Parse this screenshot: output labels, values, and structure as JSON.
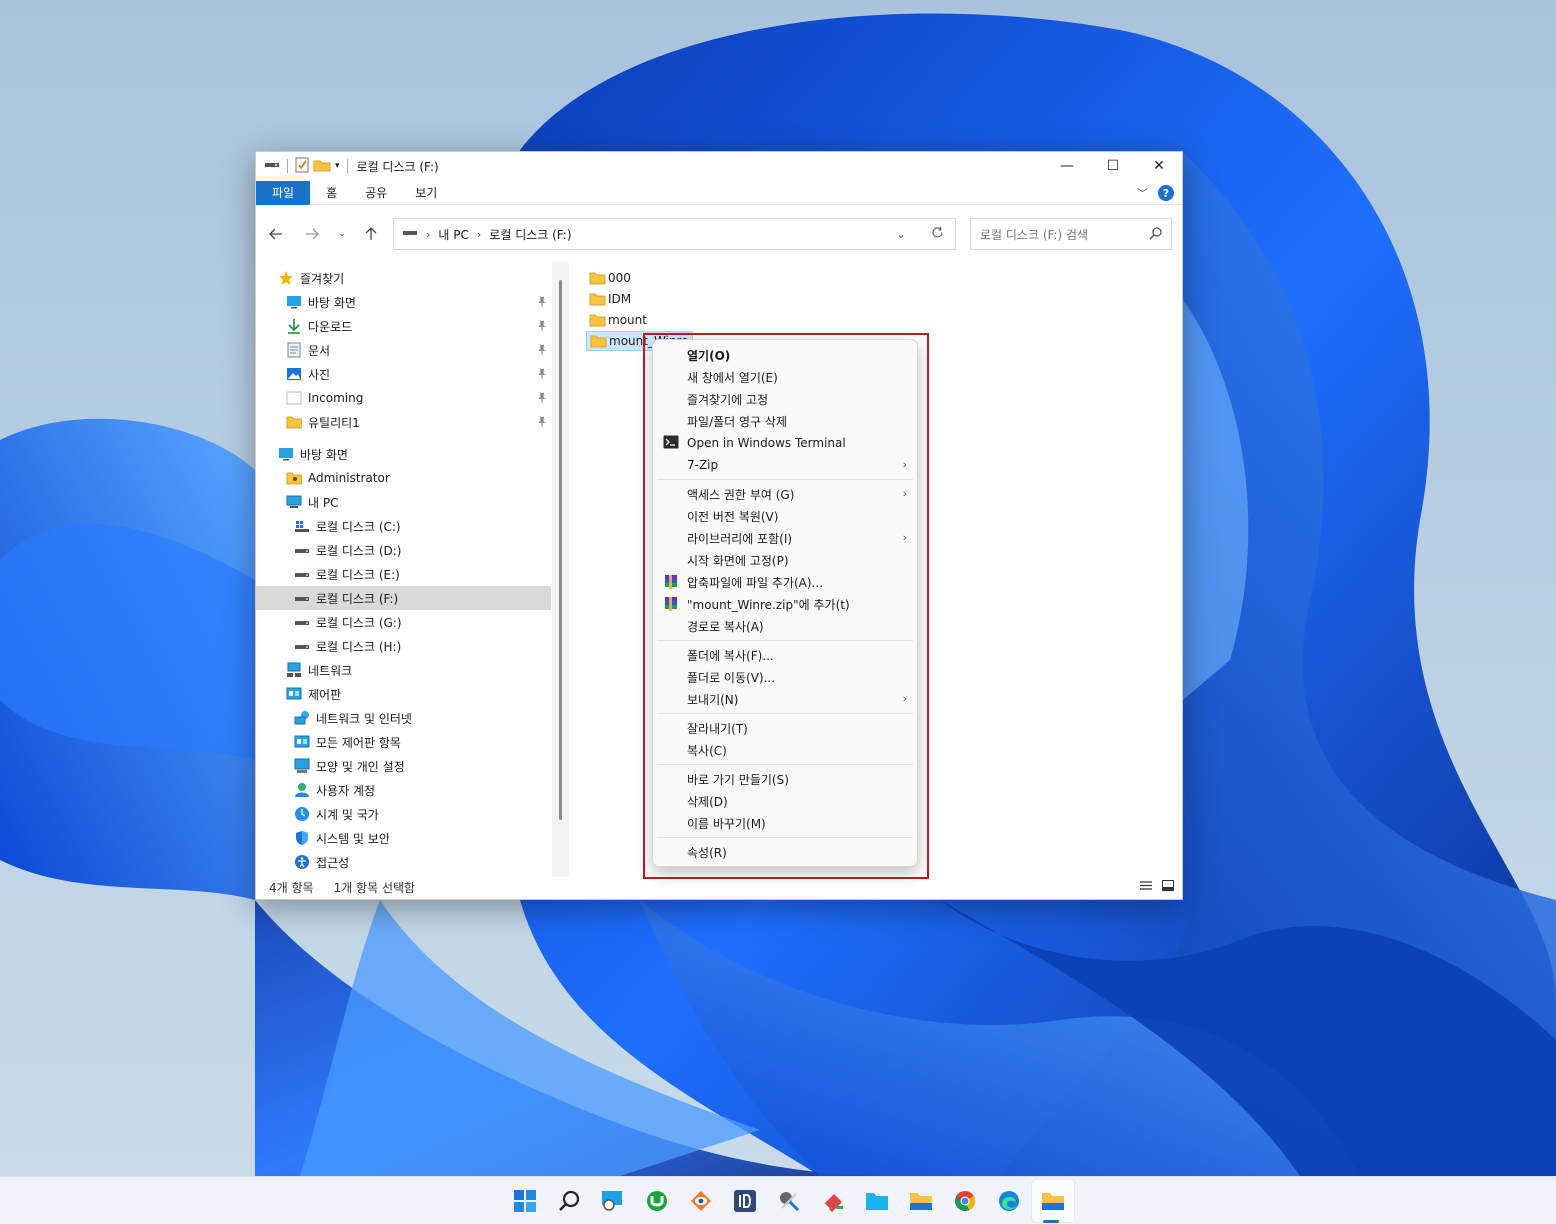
{
  "window": {
    "title": "로컬 디스크 (F:)",
    "controls": {
      "minimize": "—",
      "maximize": "☐",
      "close": "✕"
    }
  },
  "ribbon": {
    "tabs": [
      "파일",
      "홈",
      "공유",
      "보기"
    ],
    "help": "?"
  },
  "address": {
    "crumbs": [
      "내 PC",
      "로컬 디스크 (F:)"
    ],
    "search_placeholder": "로컬 디스크 (F:) 검색"
  },
  "sidebar": {
    "items": [
      {
        "label": "즐겨찾기",
        "icon": "star-icon",
        "level": 0,
        "pinned": false
      },
      {
        "label": "바탕 화면",
        "icon": "desktop-icon",
        "level": 1,
        "pinned": true
      },
      {
        "label": "다운로드",
        "icon": "download-icon",
        "level": 1,
        "pinned": true
      },
      {
        "label": "문서",
        "icon": "document-icon",
        "level": 1,
        "pinned": true
      },
      {
        "label": "사진",
        "icon": "pictures-icon",
        "level": 1,
        "pinned": true
      },
      {
        "label": "Incoming",
        "icon": "blank-folder-icon",
        "level": 1,
        "pinned": true
      },
      {
        "label": "유틸리티1",
        "icon": "folder-icon",
        "level": 1,
        "pinned": true
      },
      {
        "label": "바탕 화면",
        "icon": "desktop-icon",
        "level": 0,
        "pinned": false
      },
      {
        "label": "Administrator",
        "icon": "user-folder-icon",
        "level": 1,
        "pinned": false
      },
      {
        "label": "내 PC",
        "icon": "pc-icon",
        "level": 1,
        "pinned": false
      },
      {
        "label": "로컬 디스크 (C:)",
        "icon": "windows-drive-icon",
        "level": 2,
        "pinned": false
      },
      {
        "label": "로컬 디스크 (D:)",
        "icon": "drive-icon",
        "level": 2,
        "pinned": false
      },
      {
        "label": "로컬 디스크 (E:)",
        "icon": "drive-icon",
        "level": 2,
        "pinned": false
      },
      {
        "label": "로컬 디스크 (F:)",
        "icon": "drive-icon",
        "level": 2,
        "pinned": false,
        "selected": true
      },
      {
        "label": "로컬 디스크 (G:)",
        "icon": "drive-icon",
        "level": 2,
        "pinned": false
      },
      {
        "label": "로컬 디스크 (H:)",
        "icon": "drive-icon",
        "level": 2,
        "pinned": false
      },
      {
        "label": "네트워크",
        "icon": "network-icon",
        "level": 1,
        "pinned": false
      },
      {
        "label": "제어판",
        "icon": "control-panel-icon",
        "level": 1,
        "pinned": false
      },
      {
        "label": "네트워크 및 인터넷",
        "icon": "network-internet-icon",
        "level": 2,
        "pinned": false
      },
      {
        "label": "모든 제어판 항목",
        "icon": "control-panel-icon",
        "level": 2,
        "pinned": false
      },
      {
        "label": "모양 및 개인 설정",
        "icon": "appearance-icon",
        "level": 2,
        "pinned": false
      },
      {
        "label": "사용자 계정",
        "icon": "user-accounts-icon",
        "level": 2,
        "pinned": false
      },
      {
        "label": "시계 및 국가",
        "icon": "clock-region-icon",
        "level": 2,
        "pinned": false
      },
      {
        "label": "시스템 및 보안",
        "icon": "shield-icon",
        "level": 2,
        "pinned": false
      },
      {
        "label": "접근성",
        "icon": "accessibility-icon",
        "level": 2,
        "pinned": false
      }
    ]
  },
  "files": [
    {
      "name": "000"
    },
    {
      "name": "IDM"
    },
    {
      "name": "mount"
    },
    {
      "name": "mount_Winre",
      "selected": true
    }
  ],
  "status": {
    "count": "4개 항목",
    "selection": "1개 항목 선택함"
  },
  "context_menu": {
    "groups": [
      [
        {
          "label": "열기(O)",
          "bold": true
        },
        {
          "label": "새 창에서 열기(E)"
        },
        {
          "label": "즐겨찾기에 고정"
        },
        {
          "label": "파일/폴더 영구 삭제"
        },
        {
          "label": "Open in Windows Terminal",
          "icon": "terminal-icon"
        },
        {
          "label": "7-Zip",
          "submenu": true
        }
      ],
      [
        {
          "label": "액세스 권한 부여 (G)",
          "submenu": true
        },
        {
          "label": "이전 버전 복원(V)"
        },
        {
          "label": "라이브러리에 포함(I)",
          "submenu": true
        },
        {
          "label": "시작 화면에 고정(P)"
        },
        {
          "label": "압축파일에 파일 추가(A)...",
          "icon": "winrar-icon"
        },
        {
          "label": "\"mount_Winre.zip\"에 추가(t)",
          "icon": "winrar-icon"
        },
        {
          "label": "경로로 복사(A)"
        }
      ],
      [
        {
          "label": "폴더에 복사(F)..."
        },
        {
          "label": "폴더로 이동(V)..."
        },
        {
          "label": "보내기(N)",
          "submenu": true
        }
      ],
      [
        {
          "label": "잘라내기(T)"
        },
        {
          "label": "복사(C)"
        }
      ],
      [
        {
          "label": "바로 가기 만들기(S)"
        },
        {
          "label": "삭제(D)"
        },
        {
          "label": "이름 바꾸기(M)"
        }
      ],
      [
        {
          "label": "속성(R)"
        }
      ]
    ]
  },
  "taskbar": {
    "icons": [
      "windows-start-icon",
      "search-icon",
      "magnifier-app-icon",
      "utorrent-icon",
      "eye-app-icon",
      "1d-app-icon",
      "tools-app-icon",
      "eraser-app-icon",
      "folder-app-icon",
      "file-explorer-icon",
      "chrome-icon",
      "edge-icon",
      "file-explorer-active-icon"
    ],
    "active_index": 12,
    "accent": "#1a73c8"
  },
  "colors": {
    "accent": "#1a73c8",
    "highlight": "#c0161f",
    "selection": "#cce8ff"
  }
}
